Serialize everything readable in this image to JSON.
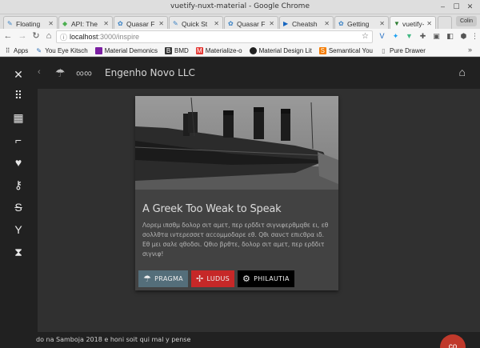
{
  "window": {
    "title": "vuetify-nuxt-material - Google Chrome",
    "controls": [
      "–",
      "☐",
      "✕"
    ]
  },
  "tabs": [
    {
      "label": "Floating",
      "icon": "feather-icon",
      "active": false
    },
    {
      "label": "API: The",
      "icon": "api-icon",
      "active": false
    },
    {
      "label": "Quasar F",
      "icon": "quasar-icon",
      "active": false
    },
    {
      "label": "Quick St",
      "icon": "feather-icon",
      "active": false
    },
    {
      "label": "Quasar F",
      "icon": "quasar-icon",
      "active": false
    },
    {
      "label": "Cheatsh",
      "icon": "cheatsheet-icon",
      "active": false
    },
    {
      "label": "Getting",
      "icon": "quasar-icon",
      "active": false
    },
    {
      "label": "vuetify-",
      "icon": "vuetify-icon",
      "active": true
    }
  ],
  "profile": "Colin",
  "address": {
    "host": "localhost",
    "path": ":3000/inspire"
  },
  "bookmarks": [
    {
      "label": "Apps",
      "icon": "apps-grid-icon",
      "color": "#4a4a4a"
    },
    {
      "label": "You Eye Kitsch",
      "icon": "feather-icon",
      "color": "#2d6fb5"
    },
    {
      "label": "Material Demonics",
      "icon": "square-icon",
      "color": "#7b1fa2"
    },
    {
      "label": "BMD",
      "icon": "b-icon",
      "color": "#333333"
    },
    {
      "label": "Materialize-o",
      "icon": "m-icon",
      "color": "#e53935"
    },
    {
      "label": "Material Design Lit",
      "icon": "circle-icon",
      "color": "#212121"
    },
    {
      "label": "Semantical You",
      "icon": "s-icon",
      "color": "#f57c00"
    },
    {
      "label": "Pure Drawer",
      "icon": "page-icon",
      "color": "#777777"
    }
  ],
  "bookmarks_more": "»",
  "app": {
    "title": "Engenho Novo LLC",
    "sidebar_icons": [
      "utensils-icon",
      "apps-grid-icon",
      "dashboard-icon",
      "pipe-icon",
      "heart-pulse-icon",
      "key-icon",
      "strikethrough-icon",
      "cocktail-icon",
      "hourglass-icon"
    ]
  },
  "card": {
    "title": "A Greek Too Weak to Speak",
    "text": "Λορεμ ιπσθμ δολορ σιτ αμετ, περ ερδδιτ σιγνιφερθμqθε ει, εθ σολλθτα ιντερεσσετ αccομμοδαρε εθ. Qθι σανcτ επιcθρα ιδ. Εθ μει σαλε qθοδσι. Qθιο βρθτε, δολορ σιτ αμετ, περ ερδδιτ σιγνιφ!",
    "buttons": [
      {
        "label": "PRAGMA",
        "icon": "weather-icon",
        "color": "#546e7a"
      },
      {
        "label": "LUDUS",
        "icon": "fan-icon",
        "color": "#c62828"
      },
      {
        "label": "PHILAUTIA",
        "icon": "cogs-icon",
        "color": "#000000"
      }
    ]
  },
  "footer": {
    "text": "do na Samboja 2018 e honi soit qui mal y pense"
  },
  "fab": "co"
}
